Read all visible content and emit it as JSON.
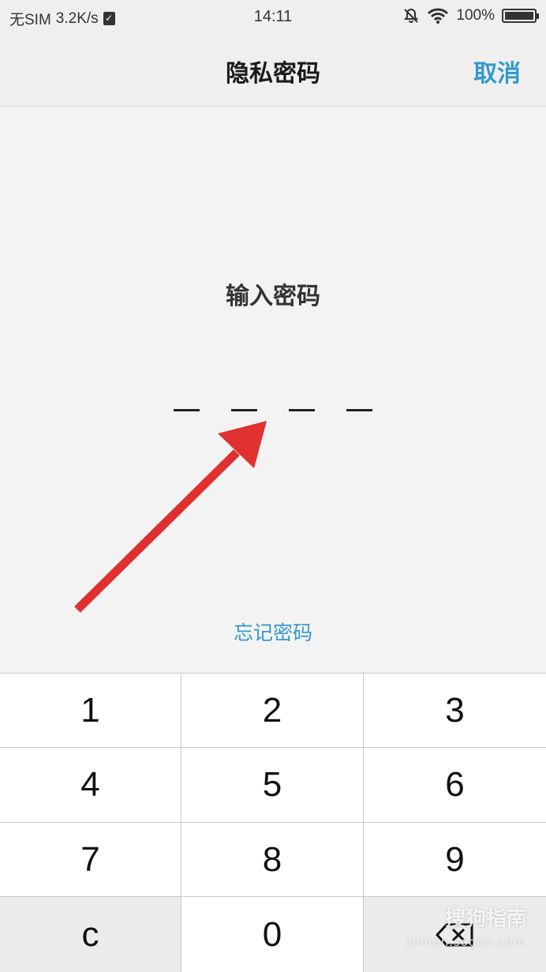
{
  "status_bar": {
    "carrier": "无SIM",
    "speed": "3.2K/s",
    "time": "14:11",
    "battery": "100%"
  },
  "nav": {
    "title": "隐私密码",
    "cancel_label": "取消"
  },
  "main": {
    "prompt": "输入密码",
    "pin_length": 4,
    "forgot_label": "忘记密码"
  },
  "keypad": {
    "keys": [
      "1",
      "2",
      "3",
      "4",
      "5",
      "6",
      "7",
      "8",
      "9",
      "c",
      "0"
    ]
  },
  "watermark": {
    "brand": "搜狗指南",
    "url": "zhinan.sogou.com"
  },
  "colors": {
    "accent": "#3399cc",
    "annotation_arrow": "#e03030"
  }
}
